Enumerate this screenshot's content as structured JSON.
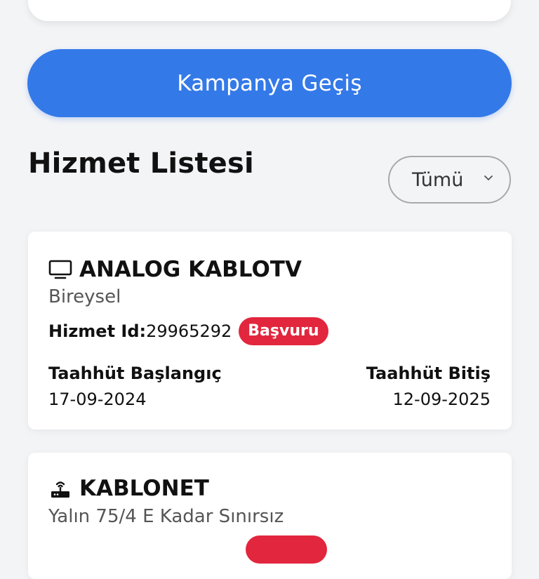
{
  "campaign_button": {
    "label": "Kampanya Geçiş"
  },
  "services_section": {
    "title": "Hizmet Listesi",
    "filter": {
      "selected": "Tümü"
    }
  },
  "services": [
    {
      "name": "ANALOG KABLOTV",
      "icon": "tv-icon",
      "plan": "Bireysel",
      "id_label": "Hizmet Id:",
      "id_value": "29965292",
      "status": "Başvuru",
      "start_label": "Taahhüt Başlangıç",
      "start_date": "17-09-2024",
      "end_label": "Taahhüt Bitiş",
      "end_date": "12-09-2025"
    },
    {
      "name": "KABLONET",
      "icon": "router-icon",
      "plan": "Yalın 75/4 E Kadar Sınırsız"
    }
  ],
  "colors": {
    "primary": "#3479e8",
    "badge": "#e2263d",
    "background": "#f3f4f6",
    "card": "#ffffff"
  }
}
